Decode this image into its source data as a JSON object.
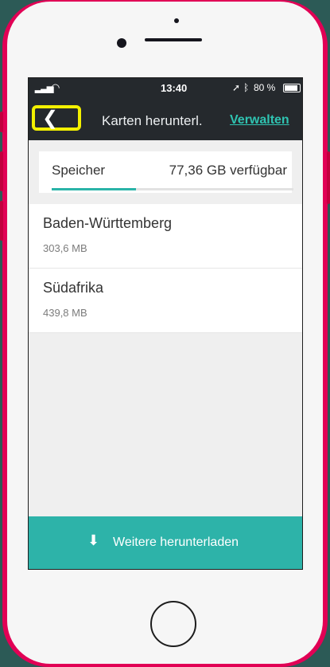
{
  "status_bar": {
    "time": "13:40",
    "battery_text": "80 %",
    "battery_level": 0.8,
    "signal_icon": "signal-icon",
    "wifi_icon": "wifi-icon",
    "location_icon": "location-arrow-icon",
    "bluetooth_icon": "bluetooth-icon"
  },
  "nav": {
    "title": "Karten herunterl.",
    "action": "Verwalten",
    "back_icon": "chevron-left-icon"
  },
  "storage": {
    "label": "Speicher",
    "value": "77,36 GB verfügbar",
    "used_fraction": 0.35
  },
  "maps": [
    {
      "name": "Baden-Württemberg",
      "size": "303,6 MB"
    },
    {
      "name": "Südafrika",
      "size": "439,8 MB"
    }
  ],
  "bottom_button": {
    "label": "Weitere herunterladen",
    "icon": "download-icon"
  },
  "colors": {
    "accent": "#2db3a9",
    "nav_bg": "#25292d",
    "highlight": "#f3f000"
  }
}
